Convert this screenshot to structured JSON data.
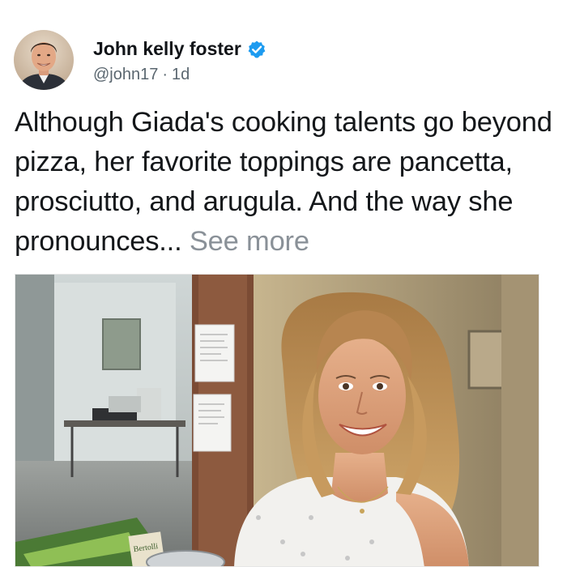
{
  "post": {
    "author": {
      "display_name": "John kelly foster",
      "handle": "@john17",
      "separator": "·",
      "time_ago": "1d",
      "verified": true
    },
    "text": "Although Giada's cooking talents go beyond pizza, her favorite toppings are pancetta, prosciutto, and arugula. And the way she pronounces...",
    "see_more_label": "See more",
    "media": {
      "package_label": "Bertolli"
    }
  },
  "colors": {
    "name": "#111418",
    "meta": "#5b6770",
    "body_text": "#14171a",
    "see_more": "#8a9198",
    "verified_badge": "#1d9bf0"
  },
  "icons": {
    "verified": "verified-badge-icon"
  }
}
